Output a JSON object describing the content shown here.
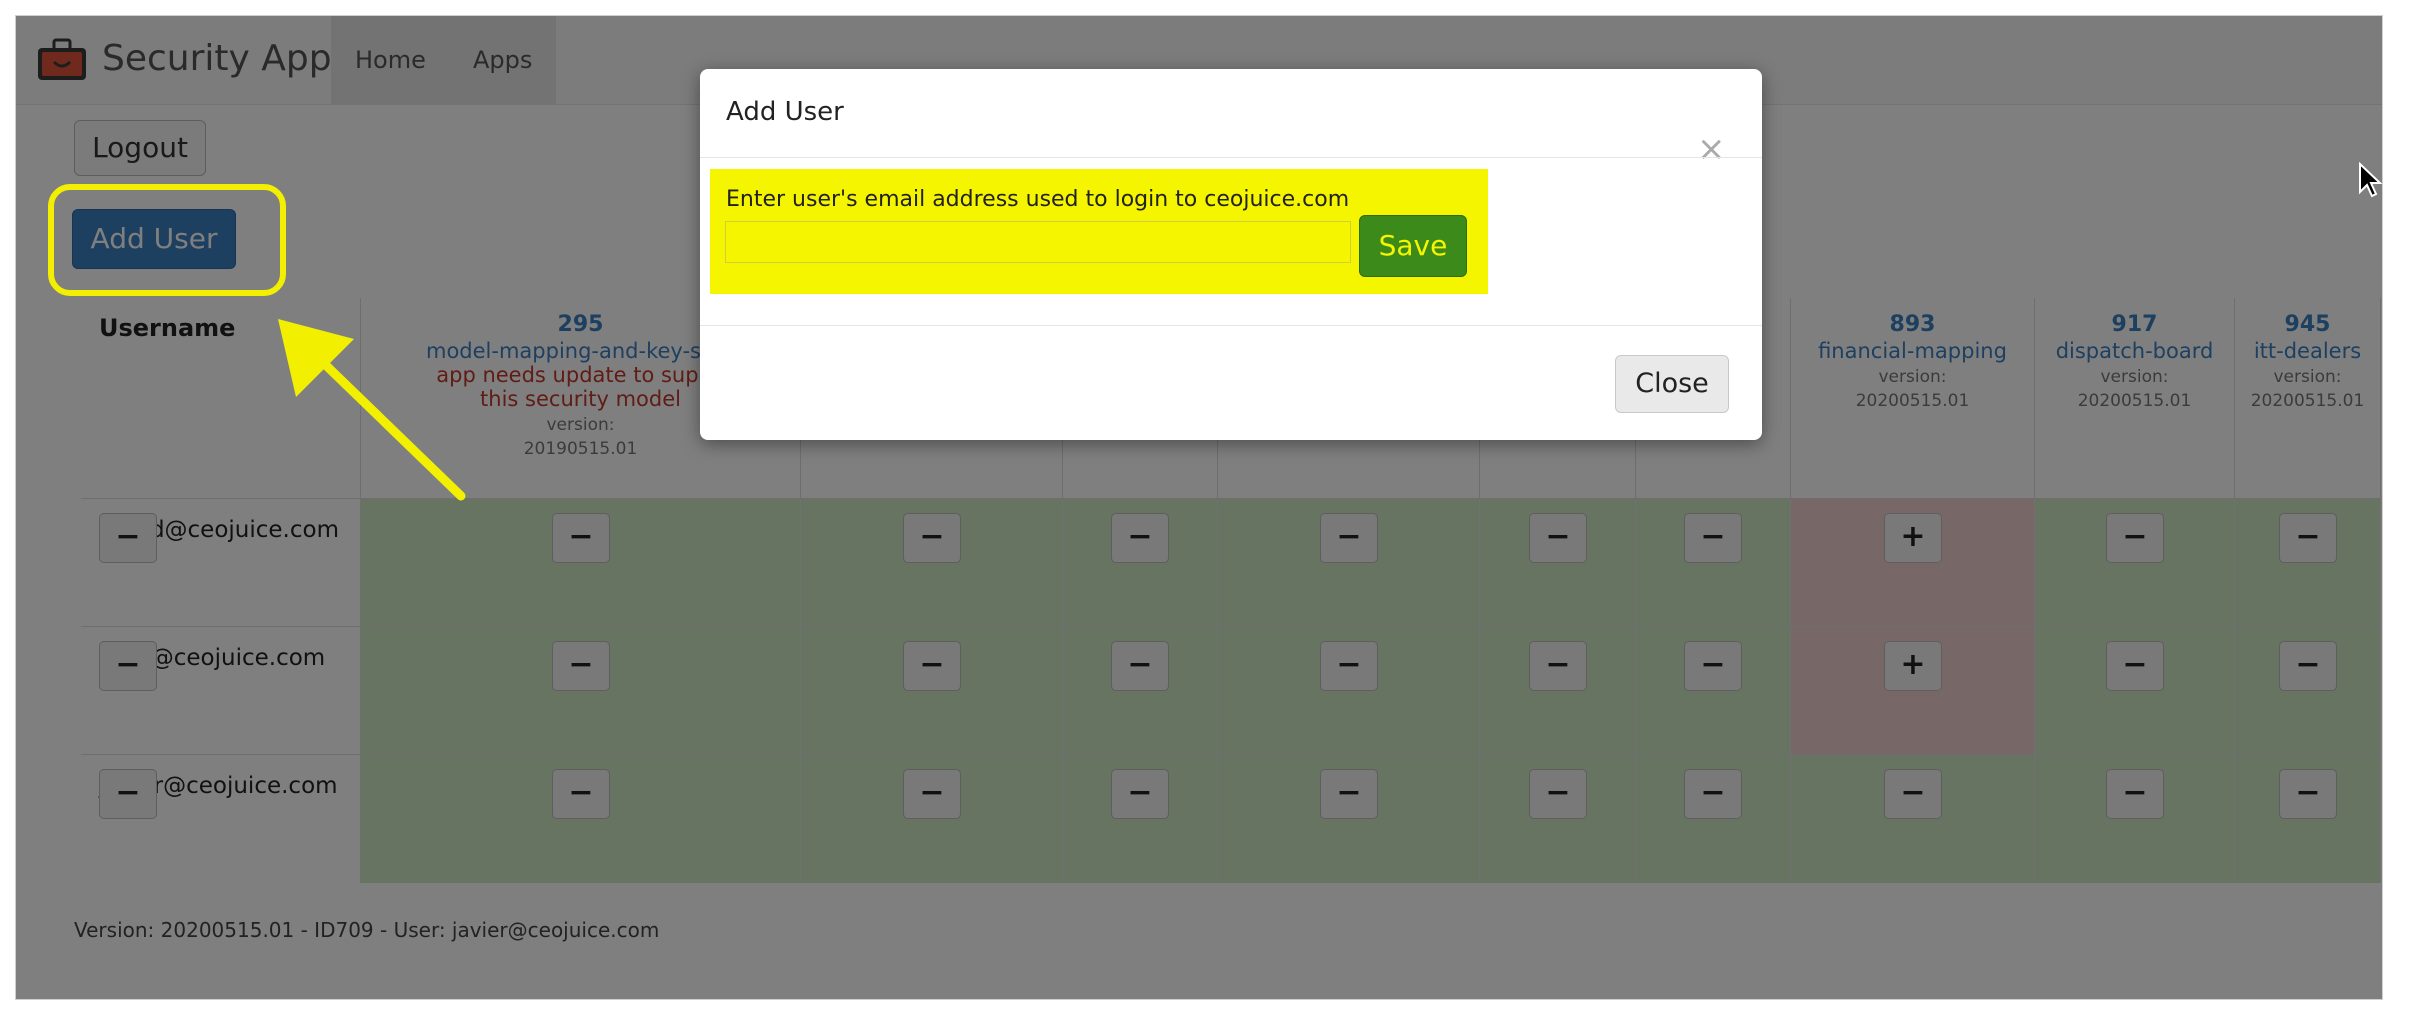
{
  "app": {
    "brand": "Security App"
  },
  "nav": {
    "home": "Home",
    "apps": "Apps"
  },
  "buttons": {
    "logout": "Logout",
    "add_user": "Add User"
  },
  "table": {
    "username_header": "Username",
    "columns": [
      {
        "id": "295",
        "name": "model-mapping-and-key-serv",
        "warn1": "app needs update to suppo",
        "warn2": "this security model",
        "version_label": "version:",
        "version": "20190515.01"
      },
      {
        "id": "",
        "name": "",
        "version_label": "",
        "version": ""
      },
      {
        "id": "",
        "name": "",
        "version_label": "",
        "version": ""
      },
      {
        "id": "",
        "name": "",
        "version_label": "",
        "version": ""
      },
      {
        "id": "",
        "name": "",
        "version_label": "",
        "version": ""
      },
      {
        "id": "",
        "name": "",
        "version_label": "",
        "version": ""
      },
      {
        "id": "893",
        "name": "financial-mapping",
        "version_label": "version:",
        "version": "20200515.01"
      },
      {
        "id": "917",
        "name": "dispatch-board",
        "version_label": "version:",
        "version": "20200515.01"
      },
      {
        "id": "945",
        "name": "itt-dealers",
        "version_label": "version:",
        "version": "20200515.01"
      }
    ],
    "rows": [
      {
        "email": "astrid@ceojuice.com",
        "user_btn": "−",
        "perms": [
          "−",
          "−",
          "−",
          "−",
          "−",
          "−",
          "+",
          "−",
          "−"
        ]
      },
      {
        "email": "gary@ceojuice.com",
        "user_btn": "−",
        "perms": [
          "−",
          "−",
          "−",
          "−",
          "−",
          "−",
          "+",
          "−",
          "−"
        ]
      },
      {
        "email": "javier@ceojuice.com",
        "user_btn": "−",
        "perms": [
          "−",
          "−",
          "−",
          "−",
          "−",
          "−",
          "−",
          "−",
          "−"
        ]
      }
    ]
  },
  "footer": {
    "text": "Version: 20200515.01 - ID709 - User: javier@ceojuice.com"
  },
  "modal": {
    "title": "Add User",
    "close_x": "×",
    "email_label": "Enter user's email address used to login to ceojuice.com",
    "email_value": "",
    "save": "Save",
    "close": "Close"
  },
  "colors": {
    "granted": "#cfe8c4",
    "denied": "#f1cfcf",
    "highlight": "#f5f500",
    "accent": "#3a7fc0",
    "save": "#3c8b1a"
  }
}
